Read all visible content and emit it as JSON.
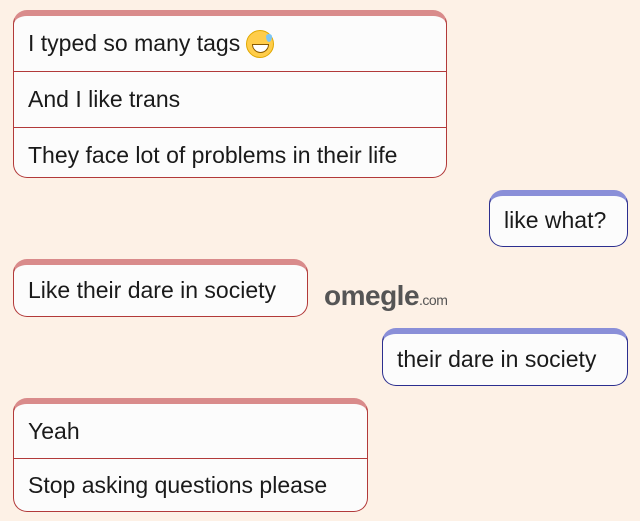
{
  "messages": [
    {
      "sender": "stranger",
      "lines": [
        "I typed so many tags",
        "And I like trans",
        "They face lot of problems in their life"
      ],
      "emoji": "grinning-sweat-emoji"
    },
    {
      "sender": "you",
      "lines": [
        "like what?"
      ]
    },
    {
      "sender": "stranger",
      "lines": [
        "Like their dare in society"
      ]
    },
    {
      "sender": "you",
      "lines": [
        "their dare in society"
      ]
    },
    {
      "sender": "stranger",
      "lines": [
        "Yeah",
        "Stop asking questions please"
      ]
    }
  ],
  "logo": {
    "main": "omegle",
    "suffix": ".com"
  },
  "colors": {
    "background": "#fdf1e6",
    "stranger_border": "#b23a3a",
    "stranger_accent": "#d98b8b",
    "you_border": "#2c2f8f",
    "you_accent": "#8a8fd8"
  }
}
